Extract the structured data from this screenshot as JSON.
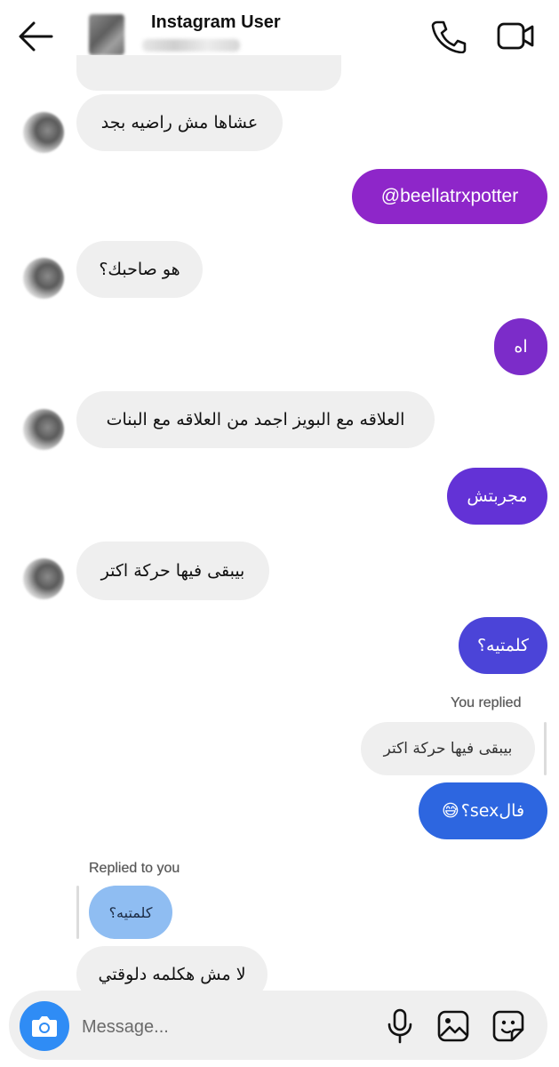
{
  "header": {
    "title": "Instagram User",
    "back_icon": "arrow-left-icon",
    "call_icon": "phone-icon",
    "video_icon": "video-camera-icon"
  },
  "messages": [
    {
      "sender": "them",
      "text": "عشاها مش راضيه بجد"
    },
    {
      "sender": "me",
      "text": "@beellatrxpotter",
      "color": "#8e26c9"
    },
    {
      "sender": "them",
      "text": "هو صاحبك؟"
    },
    {
      "sender": "me",
      "text": "اه",
      "color": "#7c2cc9"
    },
    {
      "sender": "them",
      "text": "العلاقه مع البويز اجمد من العلاقه مع البنات"
    },
    {
      "sender": "me",
      "text": "مجربتش",
      "color": "#6332d6"
    },
    {
      "sender": "them",
      "text": "بيبقى فيها حركة اكتر"
    },
    {
      "sender": "me",
      "text": "كلمتيه؟",
      "color": "#4b44d8"
    }
  ],
  "reply_me": {
    "label": "You replied",
    "quoted": "بيبقى فيها حركة اكتر",
    "text": "فالsex؟",
    "emoji": "😅",
    "color": "#2d66e0"
  },
  "reply_them": {
    "label": "Replied to you",
    "quoted": "كلمتيه؟",
    "quoted_color": "#8fbdf2",
    "text": "لا مش هكلمه دلوقتي"
  },
  "composer": {
    "placeholder": "Message...",
    "camera_icon": "camera-icon",
    "mic_icon": "microphone-icon",
    "image_icon": "image-icon",
    "sticker_icon": "sticker-icon"
  }
}
